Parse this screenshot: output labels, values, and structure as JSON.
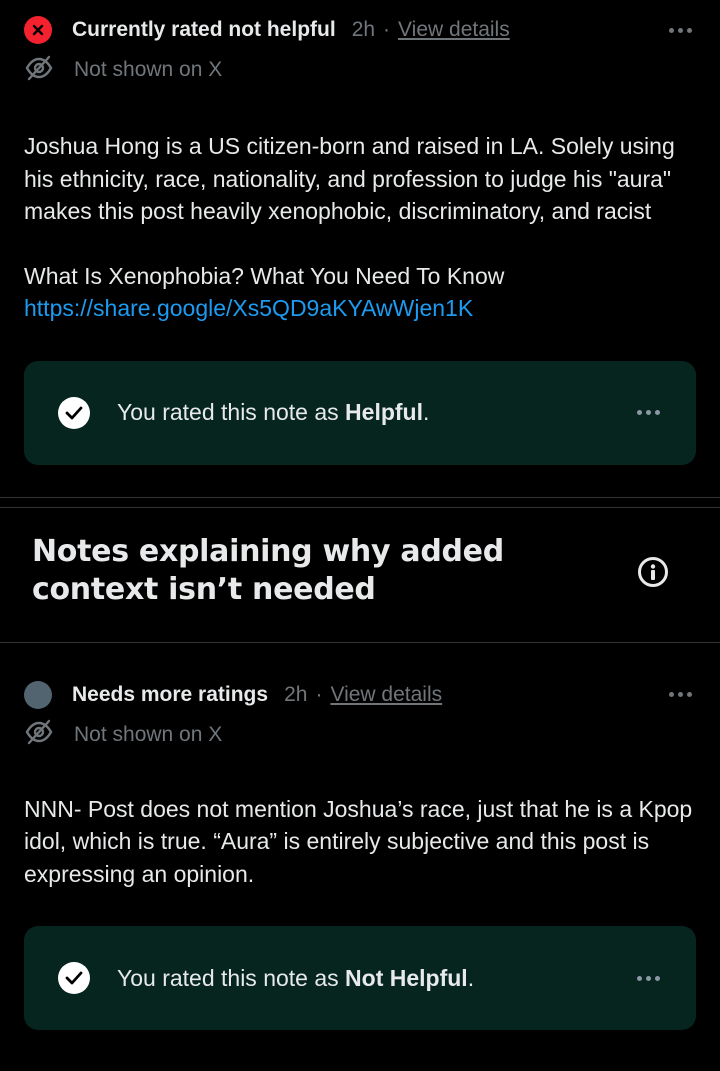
{
  "note1": {
    "status": "Currently rated not helpful",
    "time": "2h",
    "separator": "·",
    "view_details": "View details",
    "visibility": "Not shown on X",
    "body_paragraph": "Joshua Hong is a US citizen-born and raised in LA. Solely using his ethnicity, race, nationality, and profession to judge his \"aura\" makes this post heavily xenophobic, discriminatory, and racist",
    "source_title": "What Is Xenophobia? What You Need To Know",
    "source_link": "https://share.google/Xs5QD9aKYAwWjen1K",
    "rating_prefix": "You rated this note as ",
    "rating_value": "Helpful",
    "rating_suffix": "."
  },
  "section": {
    "title_line1": "Notes explaining why added",
    "title_line2": "context isn’t needed"
  },
  "note2": {
    "status": "Needs more ratings",
    "time": "2h",
    "separator": "·",
    "view_details": "View details",
    "visibility": "Not shown on X",
    "body_paragraph": "NNN- Post does not mention Joshua’s race, just that he is a Kpop idol, which is true. “Aura” is entirely subjective and this post is expressing an opinion.",
    "rating_prefix": "You rated this note as ",
    "rating_value": "Not Helpful",
    "rating_suffix": "."
  },
  "colors": {
    "status_red": "#f4212e",
    "status_gray": "#536471",
    "link": "#1d9bf0",
    "rating_bg": "#06251e"
  }
}
